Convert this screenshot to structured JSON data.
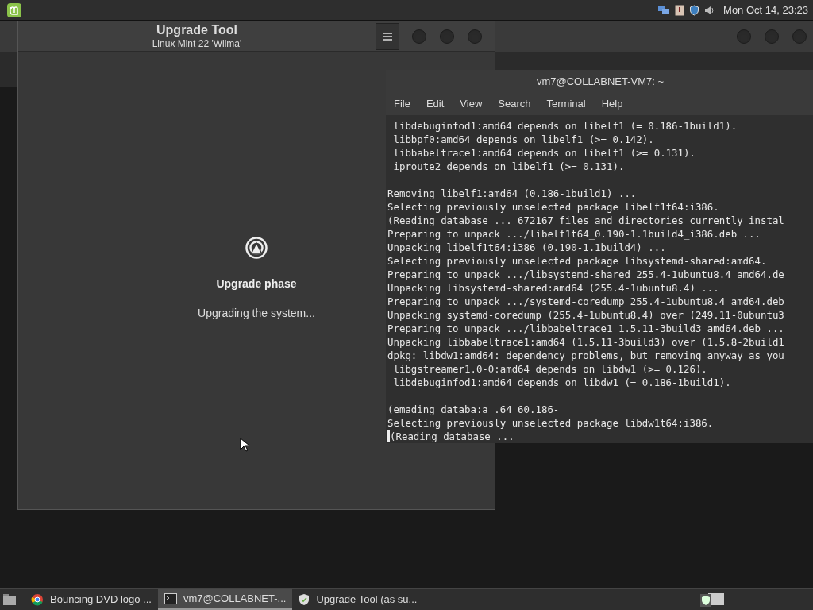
{
  "top_panel": {
    "clock": "Mon Oct 14, 23:23"
  },
  "upgrade_window": {
    "title": "Upgrade Tool",
    "subtitle": "Linux Mint 22 'Wilma'",
    "phase_title": "Upgrade phase",
    "phase_status": "Upgrading the system..."
  },
  "terminal": {
    "title": "vm7@COLLABNET-VM7: ~",
    "menu": [
      "File",
      "Edit",
      "View",
      "Search",
      "Terminal",
      "Help"
    ],
    "blocks": [
      [
        " libdebuginfod1:amd64 depends on libelf1 (= 0.186-1build1).",
        " libbpf0:amd64 depends on libelf1 (>= 0.142).",
        " libbabeltrace1:amd64 depends on libelf1 (>= 0.131).",
        " iproute2 depends on libelf1 (>= 0.131)."
      ],
      [
        "Removing libelf1:amd64 (0.186-1build1) ...",
        "Selecting previously unselected package libelf1t64:i386.",
        "(Reading database ... 672167 files and directories currently instal",
        "Preparing to unpack .../libelf1t64_0.190-1.1build4_i386.deb ...",
        "Unpacking libelf1t64:i386 (0.190-1.1build4) ...",
        "Selecting previously unselected package libsystemd-shared:amd64.",
        "Preparing to unpack .../libsystemd-shared_255.4-1ubuntu8.4_amd64.de",
        "Unpacking libsystemd-shared:amd64 (255.4-1ubuntu8.4) ...",
        "Preparing to unpack .../systemd-coredump_255.4-1ubuntu8.4_amd64.deb",
        "Unpacking systemd-coredump (255.4-1ubuntu8.4) over (249.11-0ubuntu3",
        "Preparing to unpack .../libbabeltrace1_1.5.11-3build3_amd64.deb ...",
        "Unpacking libbabeltrace1:amd64 (1.5.11-3build3) over (1.5.8-2build1",
        "dpkg: libdw1:amd64: dependency problems, but removing anyway as you",
        " libgstreamer1.0-0:amd64 depends on libdw1 (>= 0.126).",
        " libdebuginfod1:amd64 depends on libdw1 (= 0.186-1build1)."
      ],
      [
        "(emading databa:a .64 60.186-",
        "Selecting previously unselected package libdw1t64:i386."
      ]
    ],
    "prompt_line": "(Reading database ..."
  },
  "taskbar": {
    "items": [
      {
        "kind": "browser",
        "label": "Bouncing DVD logo ...",
        "selected": false
      },
      {
        "kind": "terminal",
        "label": "vm7@COLLABNET-...",
        "selected": true
      },
      {
        "kind": "shield",
        "label": "Upgrade Tool (as su...",
        "selected": false
      }
    ]
  }
}
